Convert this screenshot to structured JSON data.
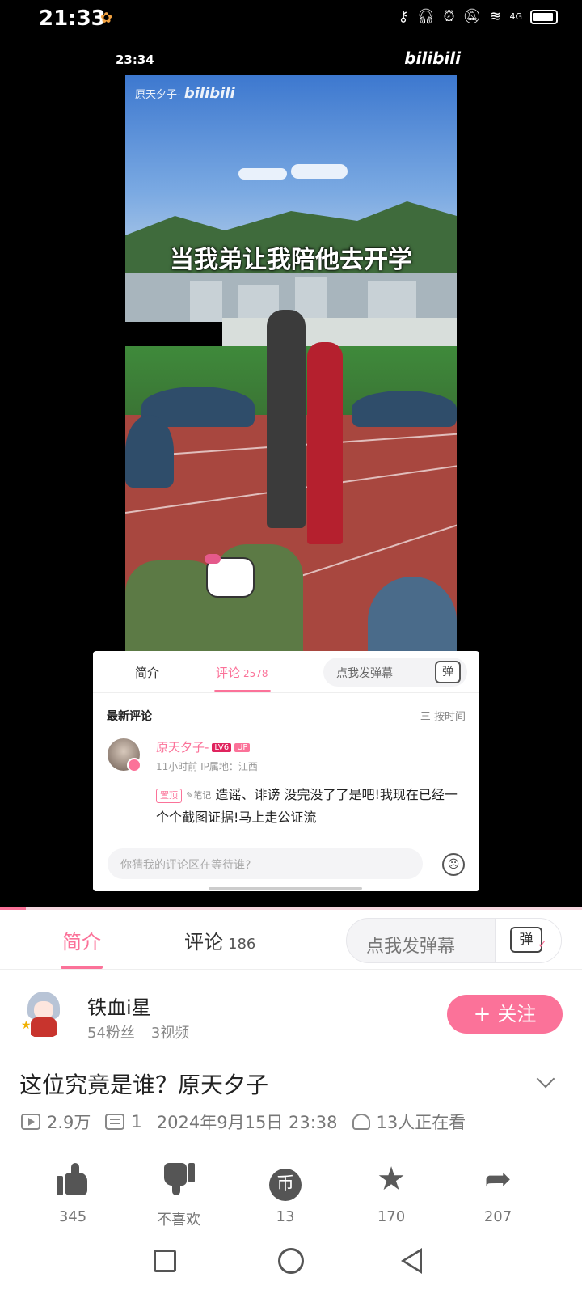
{
  "status_bar": {
    "time": "21:33",
    "indicators": [
      "key-icon",
      "headphones-icon",
      "alarm-icon",
      "mute-icon",
      "wifi-icon",
      "4g-signal-icon",
      "battery-icon"
    ],
    "network": "4G"
  },
  "video": {
    "inner_time": "23:34",
    "inner_logo": "bilibili",
    "watermark_user": "原天夕子-",
    "watermark_logo": "bilibili",
    "subtitle": "当我弟让我陪他去开学",
    "embedded_comments": {
      "tab_intro": "简介",
      "tab_comments": "评论",
      "comment_count": "2578",
      "danmaku_placeholder": "点我发弹幕",
      "danmaku_icon_label": "弹",
      "latest_label": "最新评论",
      "sort_label": "三 按时间",
      "comment": {
        "username": "原天夕子-",
        "level_badge": "LV6",
        "up_badge": "UP",
        "meta": "11小时前  IP属地：江西",
        "pinned": "置顶",
        "note": "笔记",
        "text": "造谣、诽谤 没完没了了是吧!我现在已经一个个截图证据!马上走公证流"
      },
      "input_placeholder": "你猜我的评论区在等待谁?"
    }
  },
  "progress": {
    "fraction": 0.045,
    "color": "#fb7299"
  },
  "tabs": {
    "intro": "简介",
    "comments": "评论",
    "comments_count": "186",
    "danmaku_placeholder": "点我发弹幕",
    "danmaku_icon_label": "弹"
  },
  "uploader": {
    "name": "铁血i星",
    "fans": "54粉丝",
    "videos": "3视频",
    "follow_label": "关注",
    "follow_plus": "+"
  },
  "video_info": {
    "title": "这位究竟是谁？原天夕子",
    "views": "2.9万",
    "danmaku_count": "1",
    "published": "2024年9月15日 23:38",
    "watching": "13人正在看"
  },
  "actions": [
    {
      "icon": "like-icon",
      "count": "345"
    },
    {
      "icon": "dislike-icon",
      "count": "不喜欢"
    },
    {
      "icon": "coin-icon",
      "count": "13",
      "glyph": "币"
    },
    {
      "icon": "favorite-icon",
      "count": "170",
      "glyph": "★"
    },
    {
      "icon": "share-icon",
      "count": "207",
      "glyph": "➦"
    }
  ],
  "colors": {
    "accent": "#fb7299",
    "text": "#222222",
    "muted": "#777777"
  }
}
